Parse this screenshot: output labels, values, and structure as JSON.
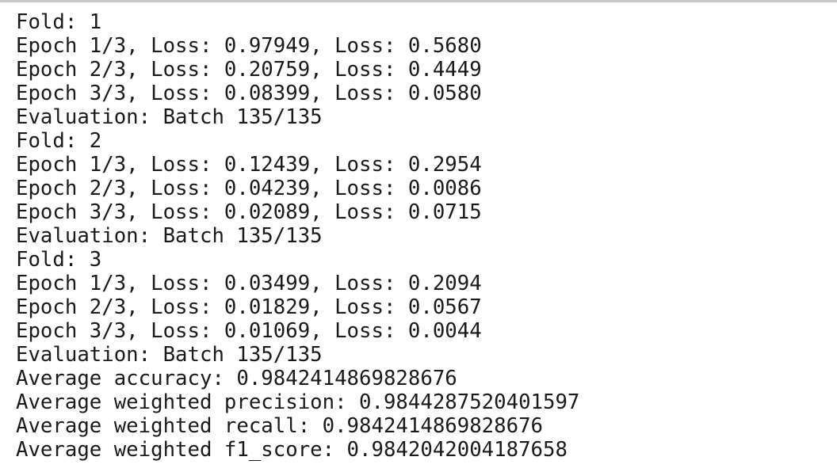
{
  "output_lines": [
    "Fold: 1",
    "Epoch 1/3, Loss: 0.97949, Loss: 0.5680",
    "Epoch 2/3, Loss: 0.20759, Loss: 0.4449",
    "Epoch 3/3, Loss: 0.08399, Loss: 0.0580",
    "Evaluation: Batch 135/135",
    "Fold: 2",
    "Epoch 1/3, Loss: 0.12439, Loss: 0.2954",
    "Epoch 2/3, Loss: 0.04239, Loss: 0.0086",
    "Epoch 3/3, Loss: 0.02089, Loss: 0.0715",
    "Evaluation: Batch 135/135",
    "Fold: 3",
    "Epoch 1/3, Loss: 0.03499, Loss: 0.2094",
    "Epoch 2/3, Loss: 0.01829, Loss: 0.0567",
    "Epoch 3/3, Loss: 0.01069, Loss: 0.0044",
    "Evaluation: Batch 135/135",
    "Average accuracy: 0.9842414869828676",
    "Average weighted precision: 0.9844287520401597",
    "Average weighted recall: 0.9842414869828676",
    "Average weighted f1_score: 0.9842042004187658"
  ]
}
